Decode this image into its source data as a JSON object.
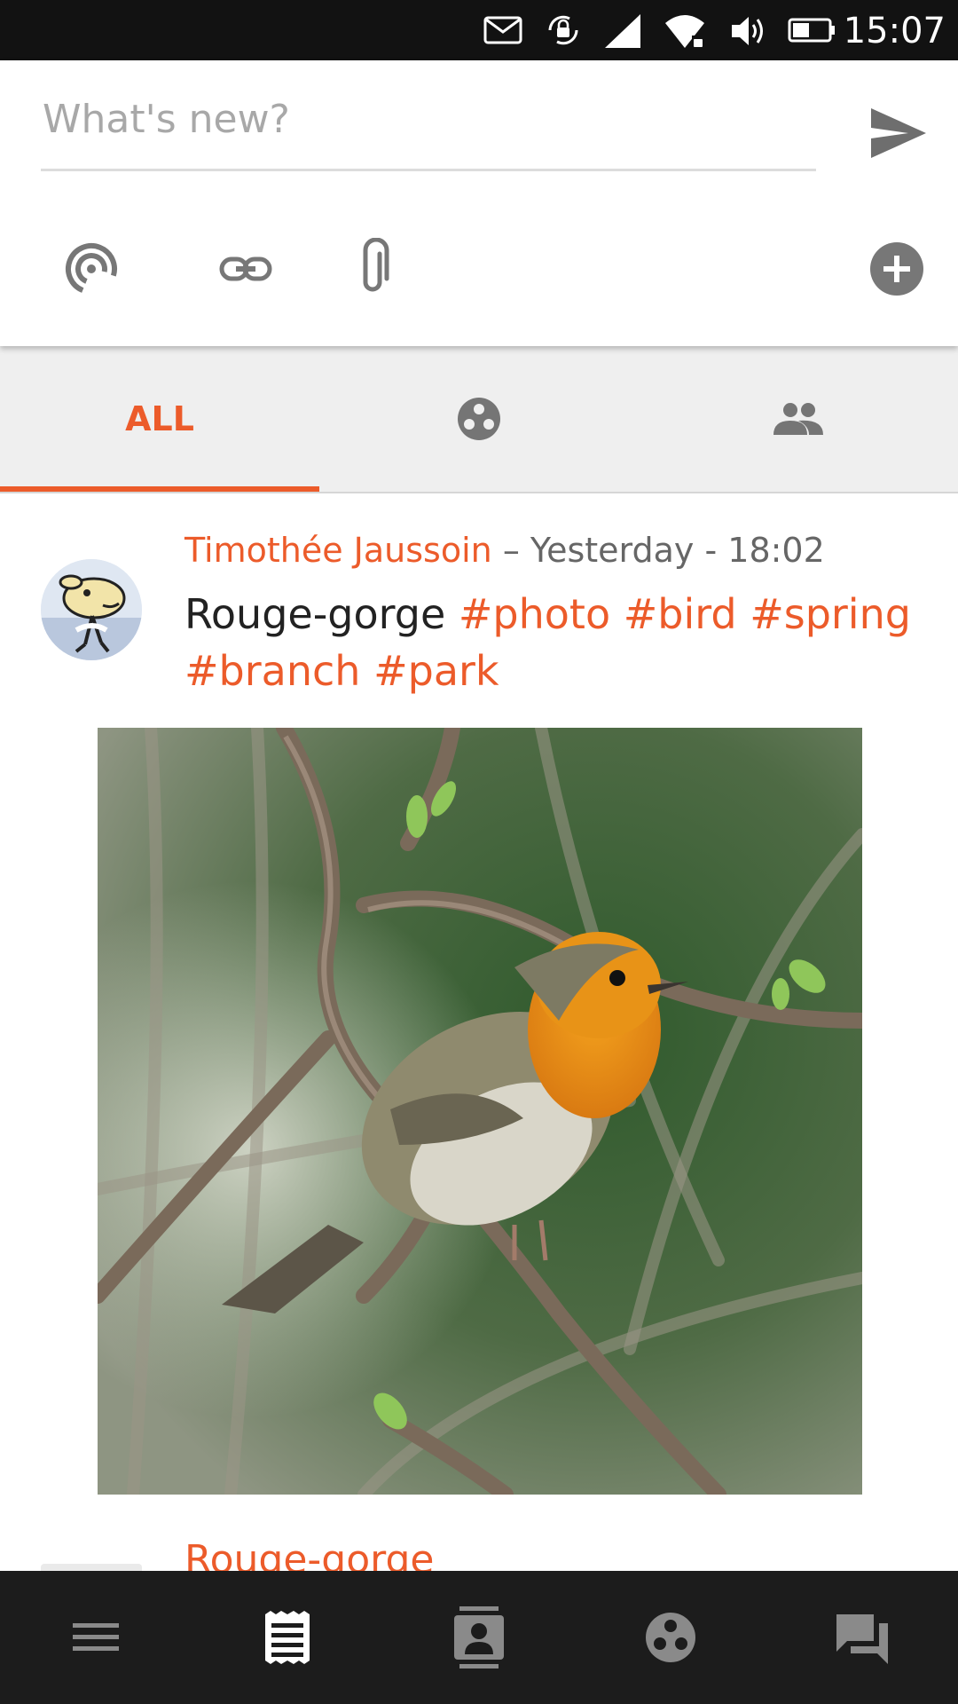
{
  "status_bar": {
    "time": "15:07",
    "icons": [
      "mail-icon",
      "rotation-lock-icon",
      "cell-signal-icon",
      "wifi-icon",
      "volume-icon",
      "battery-icon"
    ]
  },
  "composer": {
    "placeholder": "What's new?",
    "value": "",
    "send_icon": "send-icon",
    "tools": [
      "broadcast-icon",
      "link-icon",
      "attachment-icon",
      "add-circle-icon"
    ]
  },
  "tabs": [
    {
      "label": "ALL",
      "active": true
    },
    {
      "icon": "circles-icon",
      "active": false
    },
    {
      "icon": "people-icon",
      "active": false
    }
  ],
  "post": {
    "author": "Timothée Jaussoin",
    "time": "– Yesterday - 18:02",
    "text": "Rouge-gorge",
    "tags": [
      "#photo",
      "#bird",
      "#spring",
      "#branch",
      "#park"
    ]
  },
  "next_post": {
    "title": "Rouge-gorge"
  },
  "bottom_nav": [
    {
      "icon": "menu-icon"
    },
    {
      "icon": "news-icon",
      "active": true
    },
    {
      "icon": "contacts-icon"
    },
    {
      "icon": "communities-icon"
    },
    {
      "icon": "chat-icon"
    }
  ],
  "colors": {
    "accent": "#ec5b2a",
    "status_bar": "#121212",
    "bottom_bar": "#1c1c1c",
    "tab_bg": "#efefef"
  }
}
